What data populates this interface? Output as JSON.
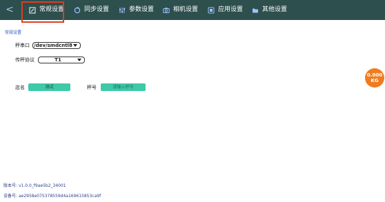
{
  "nav": {
    "back_glyph": "<",
    "tabs": [
      {
        "label": "常规设置",
        "icon": "doc-edit-icon"
      },
      {
        "label": "同步设置",
        "icon": "sync-icon"
      },
      {
        "label": "参数设置",
        "icon": "sliders-icon"
      },
      {
        "label": "相机设置",
        "icon": "camera-icon"
      },
      {
        "label": "应用设置",
        "icon": "app-icon"
      },
      {
        "label": "其他设置",
        "icon": "folder-icon"
      }
    ],
    "active_index": 0,
    "highlight_color": "#e03b22"
  },
  "section_title": "常规设置",
  "scale_port": {
    "label": "秤串口",
    "value": "/dev/smdcntl8"
  },
  "scale_protocol": {
    "label": "传秤协议",
    "value": "T1"
  },
  "store": {
    "label": "店名",
    "value": "测试"
  },
  "scale_no": {
    "label": "秤号",
    "placeholder": "请输入秤号"
  },
  "weight": {
    "value": "0.000",
    "unit": "KG"
  },
  "version": {
    "label": "版本号:",
    "value": "v1.0.0_f9ae5b2_34001"
  },
  "device": {
    "label": "设备号:",
    "value": "ae2958e075378559d4a169615853ca9f"
  },
  "colors": {
    "topbar": "#2d4f4e",
    "accent_teal": "#3ec9a7",
    "weight_badge": "#f07c1f",
    "link_blue": "#3554c8"
  }
}
